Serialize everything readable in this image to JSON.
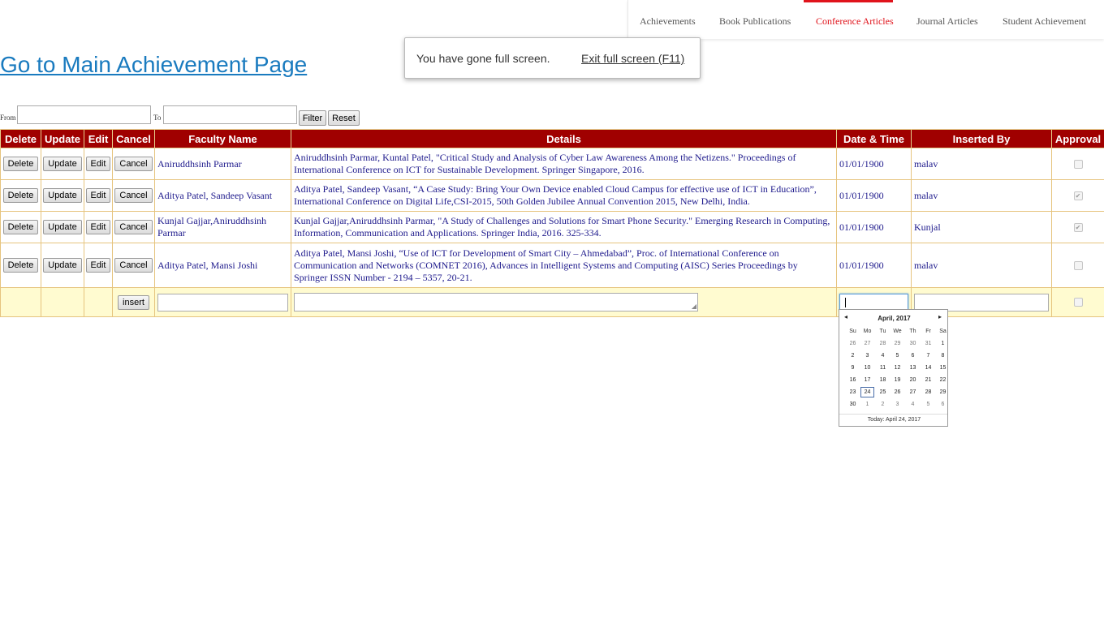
{
  "nav": {
    "items": [
      {
        "label": "Achievements"
      },
      {
        "label": "Book Publications"
      },
      {
        "label": "Conference Articles"
      },
      {
        "label": "Journal Articles"
      },
      {
        "label": "Student Achievement"
      }
    ],
    "active": "Conference Articles"
  },
  "toast": {
    "message": "You have gone full screen.",
    "exit_label": "Exit full screen (F11)"
  },
  "main_link": "Go to Main Achievement Page",
  "filter": {
    "from_label": "From",
    "to_label": "To",
    "from_value": "",
    "to_value": "",
    "filter_button": "Filter",
    "reset_button": "Reset"
  },
  "table": {
    "headers": [
      "Delete",
      "Update",
      "Edit",
      "Cancel",
      "Faculty Name",
      "Details",
      "Date & Time",
      "Inserted By",
      "Approval"
    ],
    "button_labels": {
      "delete": "Delete",
      "update": "Update",
      "edit": "Edit",
      "cancel": "Cancel"
    },
    "rows": [
      {
        "faculty": "Aniruddhsinh Parmar",
        "details": "Aniruddhsinh Parmar, Kuntal Patel, \"Critical Study and Analysis of Cyber Law Awareness Among the Netizens.\" Proceedings of International Conference on ICT for Sustainable Development. Springer Singapore, 2016.",
        "date": "01/01/1900",
        "inserted_by": "malav",
        "approved": false
      },
      {
        "faculty": "Aditya Patel, Sandeep Vasant",
        "details": "Aditya Patel, Sandeep Vasant, “A Case Study: Bring Your Own Device enabled Cloud Campus for effective use of ICT in Education”, International Conference on Digital Life,CSI-2015, 50th Golden Jubilee Annual Convention 2015, New Delhi, India.",
        "date": "01/01/1900",
        "inserted_by": "malav",
        "approved": true
      },
      {
        "faculty": "Kunjal Gajjar,Aniruddhsinh Parmar",
        "details": "Kunjal Gajjar,Aniruddhsinh Parmar, \"A Study of Challenges and Solutions for Smart Phone Security.\" Emerging Research in Computing, Information, Communication and Applications. Springer India, 2016. 325-334.",
        "date": "01/01/1900",
        "inserted_by": "Kunjal",
        "approved": true
      },
      {
        "faculty": "Aditya Patel, Mansi Joshi",
        "details": "Aditya Patel, Mansi Joshi, “Use of ICT for Development of Smart City – Ahmedabad”, Proc. of International Conference on Communication and Networks (COMNET 2016), Advances in Intelligent Systems and Computing (AISC) Series Proceedings by Springer ISSN Number - 2194 – 5357, 20-21.",
        "date": "01/01/1900",
        "inserted_by": "malav",
        "approved": false
      }
    ],
    "insert_button": "insert"
  },
  "datepicker": {
    "prev": "◂",
    "next": "▸",
    "title": "April, 2017",
    "weekdays": [
      "Su",
      "Mo",
      "Tu",
      "We",
      "Th",
      "Fr",
      "Sa"
    ],
    "weeks": [
      [
        "26",
        "27",
        "28",
        "29",
        "30",
        "31",
        "1"
      ],
      [
        "2",
        "3",
        "4",
        "5",
        "6",
        "7",
        "8"
      ],
      [
        "9",
        "10",
        "11",
        "12",
        "13",
        "14",
        "15"
      ],
      [
        "16",
        "17",
        "18",
        "19",
        "20",
        "21",
        "22"
      ],
      [
        "23",
        "24",
        "25",
        "26",
        "27",
        "28",
        "29"
      ],
      [
        "30",
        "1",
        "2",
        "3",
        "4",
        "5",
        "6"
      ]
    ],
    "selected": "24",
    "today_label": "Today: April 24, 2017"
  }
}
